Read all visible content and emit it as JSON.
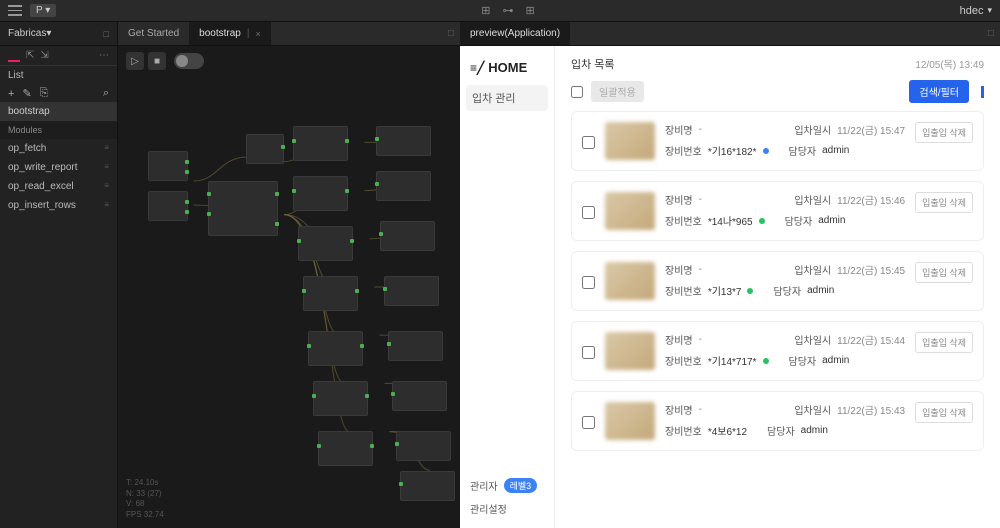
{
  "topbar": {
    "badge": "P ▾",
    "user": "hdec"
  },
  "sidebar": {
    "title": "Fabricas",
    "list_label": "List",
    "items": [
      "bootstrap"
    ],
    "modules_label": "Modules",
    "modules": [
      "op_fetch",
      "op_write_report",
      "op_read_excel",
      "op_insert_rows"
    ]
  },
  "tabs": [
    {
      "label": "Get Started",
      "active": false,
      "closable": false
    },
    {
      "label": "bootstrap",
      "active": true,
      "closable": true
    }
  ],
  "graph_stats": [
    "T: 24.10s",
    "N: 33 (27)",
    "V: 68",
    "FPS 32.74"
  ],
  "preview_tab": "preview(Application)",
  "preview": {
    "home": "HOME",
    "nav": [
      "입차 관리"
    ],
    "admin_label": "관리자",
    "level_badge": "레벨3",
    "settings_label": "관리설정",
    "page_title": "입차 목록",
    "datetime": "12/05(목) 13:49",
    "apply_btn": "일괄적용",
    "filter_btn": "검색/필터",
    "delete_btn": "입출입 삭제",
    "field_equip": "장비명",
    "field_time": "입차일시",
    "field_no": "장비번호",
    "field_owner": "담당자",
    "rows": [
      {
        "equip": "-",
        "time": "11/22(금) 15:47",
        "no": "*기16*182*",
        "dot": "blue",
        "owner": "admin"
      },
      {
        "equip": "-",
        "time": "11/22(금) 15:46",
        "no": "*14나*965",
        "dot": "green",
        "owner": "admin"
      },
      {
        "equip": "-",
        "time": "11/22(금) 15:45",
        "no": "*기13*7",
        "dot": "green",
        "owner": "admin"
      },
      {
        "equip": "-",
        "time": "11/22(금) 15:44",
        "no": "*기14*717*",
        "dot": "green",
        "owner": "admin"
      },
      {
        "equip": "-",
        "time": "11/22(금) 15:43",
        "no": "*4보6*12",
        "dot": "",
        "owner": "admin"
      }
    ]
  }
}
